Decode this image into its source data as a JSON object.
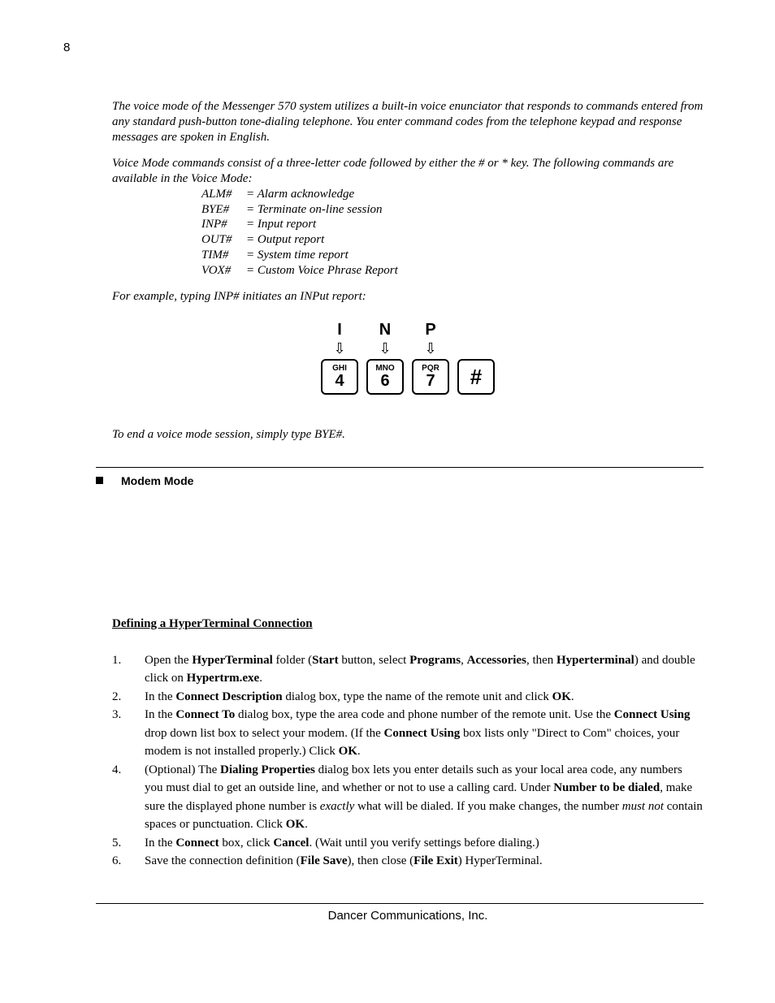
{
  "page_number": "8",
  "intro": {
    "p1": "The voice mode of the Messenger 570 system utilizes a built-in voice enunciator that responds to commands entered from any standard push-button tone-dialing telephone. You enter command codes from the telephone keypad and response messages are spoken in English.",
    "p2": "Voice Mode commands consist of a three-letter code followed by either the # or * key. The following commands are available in the Voice Mode:"
  },
  "commands": [
    {
      "code": "ALM#",
      "desc": "= Alarm acknowledge"
    },
    {
      "code": "BYE#",
      "desc": "= Terminate on-line session"
    },
    {
      "code": "INP#",
      "desc": "= Input report"
    },
    {
      "code": "OUT#",
      "desc": "= Output report"
    },
    {
      "code": "TIM#",
      "desc": "= System time report"
    },
    {
      "code": "VOX#",
      "desc": "= Custom Voice Phrase Report"
    }
  ],
  "example_text": "For example, typing INP# initiates an INPut report:",
  "keypad": {
    "letters": [
      "I",
      "N",
      "P"
    ],
    "keys": [
      {
        "sub": "GHI",
        "num": "4"
      },
      {
        "sub": "MNO",
        "num": "6"
      },
      {
        "sub": "PQR",
        "num": "7"
      },
      {
        "hash": "#"
      }
    ]
  },
  "end_session": "To end a voice mode session, simply type BYE#.",
  "section2": {
    "title": "Modem Mode",
    "subhead": "Defining a HyperTerminal Connection",
    "s1_a": "1.",
    "s1_b": "Open the ",
    "s1_c": "HyperTerminal",
    "s1_d": " folder (",
    "s1_e": "Start",
    "s1_f": " button, select ",
    "s1_g": "Programs",
    "s1_h": ", ",
    "s1_i": "Accessories",
    "s1_j": ", then ",
    "s1_k": "Hyperterminal",
    "s1_l": ") and double click on ",
    "s1_m": "Hypertrm.exe",
    "s1_n": ".",
    "s2_a": "2.",
    "s2_b": "In the ",
    "s2_c": "Connect Description",
    "s2_d": " dialog box, type the name of the remote unit and click ",
    "s2_e": "OK",
    "s2_f": ".",
    "s3_a": "3.",
    "s3_b": "In the ",
    "s3_c": "Connect To",
    "s3_d": " dialog box, type the area code and phone number of the remote unit. Use the ",
    "s3_e": "Connect Using",
    "s3_f": " drop down list box to select your modem. (If the ",
    "s3_g": "Connect Using",
    "s3_h": " box lists only \"Direct to Com\" choices, your modem is not installed properly.) Click ",
    "s3_i": "OK",
    "s3_j": ".",
    "s4_a": "4.",
    "s4_b": "(Optional) The ",
    "s4_c": "Dialing Properties",
    "s4_d": " dialog box lets you enter details such as your local area code, any numbers you must dial to get an outside line, and whether or not to use a calling card. Under ",
    "s4_e": "Number to be dialed",
    "s4_f": ", make sure the displayed phone number is ",
    "s4_g": "exactly",
    "s4_h": " what will be dialed. If you make changes, the number ",
    "s4_i": "must not",
    "s4_j": " contain spaces or punctuation. Click ",
    "s4_k": "OK",
    "s4_l": ".",
    "s5_a": "5.",
    "s5_b": "In the ",
    "s5_c": "Connect",
    "s5_d": " box, click ",
    "s5_e": "Cancel",
    "s5_f": ". (Wait until you verify settings before dialing.)",
    "s6_a": "6.",
    "s6_b": "Save the connection definition (",
    "s6_c": "File Save",
    "s6_d": "), then close (",
    "s6_e": "File Exit",
    "s6_f": ") HyperTerminal."
  },
  "footer": "Dancer Communications, Inc."
}
